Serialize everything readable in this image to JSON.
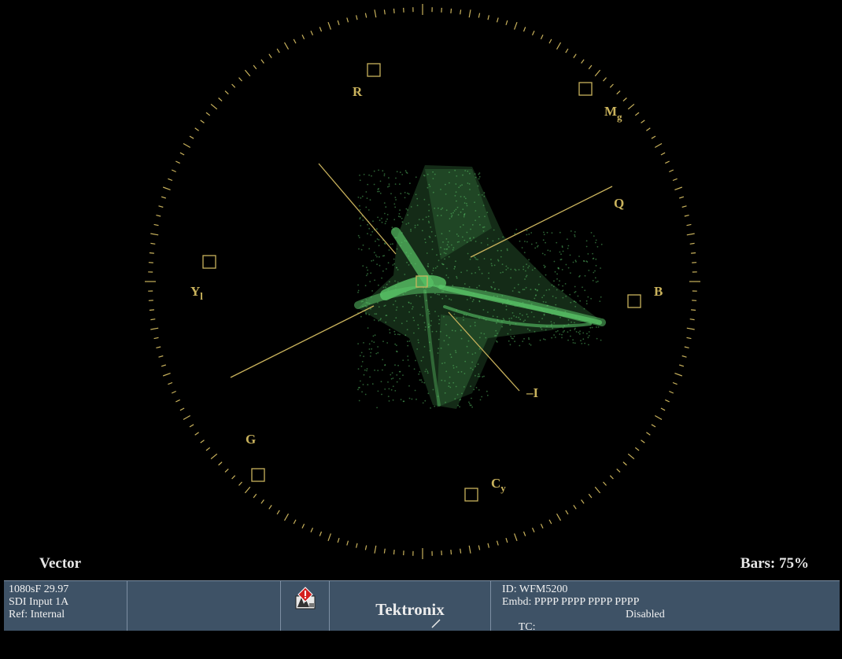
{
  "scope": {
    "mode_label": "Vector",
    "bars_label": "Bars: 75%",
    "trace_color": "#59c467",
    "graticule_color": "#c9b25c",
    "targets": {
      "R": {
        "main": "R",
        "sub": ""
      },
      "Mg": {
        "main": "M",
        "sub": "g"
      },
      "B": {
        "main": "B",
        "sub": ""
      },
      "Cy": {
        "main": "C",
        "sub": "y"
      },
      "G": {
        "main": "G",
        "sub": ""
      },
      "Yl": {
        "main": "Y",
        "sub": "l"
      }
    },
    "axis_labels": {
      "Q": "Q",
      "I": "–I"
    }
  },
  "status": {
    "format": "1080sF 29.97",
    "input": "SDI Input 1A",
    "reference": "Ref: Internal",
    "alarm_icon": "alarm-warning-icon",
    "brand": "Tektronix",
    "id": "ID: WFM5200",
    "embedded": "Embd: PPPP PPPP PPPP PPPP",
    "tc_label": "TC:",
    "tc_value": "Disabled"
  }
}
